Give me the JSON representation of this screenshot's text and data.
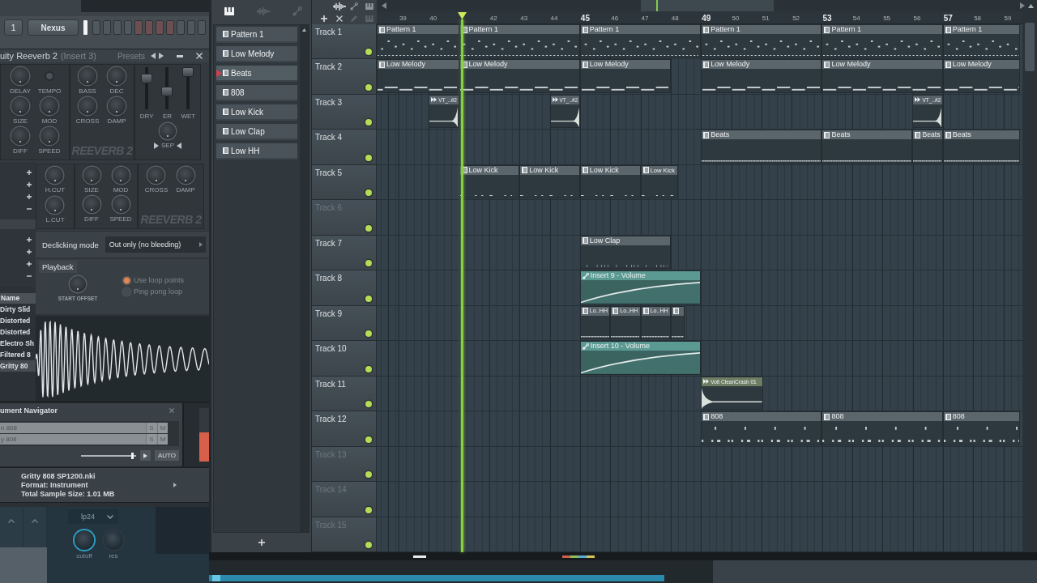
{
  "channel_rack": {
    "rows": [
      {
        "number": "1",
        "name": "Nexus",
        "steps": [
          {
            "on": false
          },
          {
            "on": false
          },
          {
            "on": false
          },
          {
            "on": false
          },
          {
            "on": false
          },
          {
            "on": false
          },
          {
            "on": false
          },
          {
            "on": false
          },
          {
            "on": false
          },
          {
            "on": false
          },
          {
            "on": false
          }
        ]
      }
    ]
  },
  "reverb": {
    "title": "uity Reeverb 2",
    "insert": "(Insert 3)",
    "presets": "Presets",
    "knob_groups": [
      [
        {
          "label": "DELAY",
          "kind": "knob"
        },
        {
          "label": "TEMPO",
          "kind": "led"
        },
        {
          "label": "SIZE",
          "kind": "knob"
        },
        {
          "label": "MOD",
          "kind": "knob"
        },
        {
          "label": "DIFF",
          "kind": "knob"
        },
        {
          "label": "SPEED",
          "kind": "knob"
        }
      ],
      [
        {
          "label": "BASS",
          "kind": "knob"
        },
        {
          "label": "DEC",
          "kind": "knob"
        },
        {
          "label": "CROSS",
          "kind": "knob"
        },
        {
          "label": "DAMP",
          "kind": "knob"
        }
      ]
    ],
    "logo": "REEVERB 2",
    "faders": [
      {
        "label": "DRY",
        "level": 0.8
      },
      {
        "label": "ER",
        "level": 0.4
      },
      {
        "label": "WET",
        "level": 1
      }
    ],
    "sep": "SEP"
  },
  "reverb_lower": {
    "knob_groups": [
      [
        {
          "label": "H.CUT",
          "kind": "knob"
        },
        {
          "label": "L.CUT",
          "kind": "knob"
        }
      ],
      [
        {
          "label": "SIZE",
          "kind": "knob"
        },
        {
          "label": "MOD",
          "kind": "knob"
        },
        {
          "label": "DIFF",
          "kind": "knob"
        },
        {
          "label": "SPEED",
          "kind": "knob"
        }
      ],
      [
        {
          "label": "CROSS",
          "kind": "knob"
        },
        {
          "label": "DAMP",
          "kind": "knob"
        }
      ]
    ],
    "logo": "REEVERB 2"
  },
  "browser": {
    "tree_groups": [
      [
        {
          "expanded": false
        },
        {
          "expanded": false
        },
        {
          "expanded": false
        },
        {
          "expanded": true
        }
      ],
      [
        {
          "expanded": false
        },
        {
          "expanded": false
        },
        {
          "expanded": false
        },
        {
          "expanded": true
        }
      ]
    ],
    "column": "Name",
    "items": [
      {
        "name": "Dirty Slid",
        "selected": false
      },
      {
        "name": "Distorted",
        "selected": false
      },
      {
        "name": "Distorted",
        "selected": false
      },
      {
        "name": "Electro Sh",
        "selected": false
      },
      {
        "name": "Filtered 8",
        "selected": false
      },
      {
        "name": "Gritty 80",
        "selected": true
      }
    ]
  },
  "sampler": {
    "declicking": {
      "label": "Declicking mode",
      "value": "Out only (no bleeding)"
    },
    "playback": {
      "title": "Playback",
      "knob": "START OFFSET",
      "options": [
        {
          "label": "Use loop points",
          "checked": true
        },
        {
          "label": "Ping pong loop",
          "checked": false
        }
      ]
    }
  },
  "instrument_navigator": {
    "title": "ument Navigator",
    "rows": [
      {
        "name": "n 808",
        "solo": "S",
        "mute": "M"
      },
      {
        "name": "y 808",
        "solo": "S",
        "mute": "M"
      }
    ],
    "volume": {
      "level": 0.95
    },
    "auto": "AUTO",
    "meter": {
      "level": 0.55
    }
  },
  "file_info": {
    "lines": [
      "Gritty 808 SP1200.nki",
      "Format: Instrument",
      "Total Sample Size: 1.01 MB"
    ]
  },
  "synth": {
    "filter": "lp24",
    "knobs": [
      {
        "label": "cutoff"
      },
      {
        "label": "res"
      }
    ]
  },
  "playlist": {
    "patterns": [
      {
        "name": "Pattern 1",
        "selected": false
      },
      {
        "name": "Low Melody",
        "selected": false
      },
      {
        "name": "Beats",
        "selected": true
      },
      {
        "name": "808",
        "selected": false
      },
      {
        "name": "Low Kick",
        "selected": false
      },
      {
        "name": "Low Clap",
        "selected": false
      },
      {
        "name": "Low HH",
        "selected": false
      }
    ],
    "ruler": [
      {
        "label": "39",
        "major": false
      },
      {
        "label": "40",
        "major": false
      },
      {
        "label": "42",
        "major": false
      },
      {
        "label": "43",
        "major": false
      },
      {
        "label": "44",
        "major": false
      },
      {
        "label": "45",
        "major": true
      },
      {
        "label": "46",
        "major": false
      },
      {
        "label": "47",
        "major": false
      },
      {
        "label": "48",
        "major": false
      },
      {
        "label": "49",
        "major": true
      },
      {
        "label": "50",
        "major": false
      },
      {
        "label": "51",
        "major": false
      },
      {
        "label": "52",
        "major": false
      },
      {
        "label": "53",
        "major": true
      },
      {
        "label": "54",
        "major": false
      },
      {
        "label": "55",
        "major": false
      },
      {
        "label": "56",
        "major": false
      },
      {
        "label": "57",
        "major": true
      },
      {
        "label": "58",
        "major": false
      },
      {
        "label": "59",
        "major": false
      }
    ],
    "tracks": [
      {
        "name": "Track 1",
        "dimmed": false,
        "muted": false,
        "clips": [
          {
            "kind": "pattern",
            "label": "Pattern 1"
          },
          {
            "kind": "pattern",
            "label": "Pattern 1"
          },
          {
            "kind": "pattern",
            "label": "Pattern 1"
          },
          {
            "kind": "pattern",
            "label": "Pattern 1"
          },
          {
            "kind": "pattern",
            "label": "Pattern 1"
          },
          {
            "kind": "pattern",
            "label": "Pattern 1"
          }
        ]
      },
      {
        "name": "Track 2",
        "dimmed": false,
        "muted": false,
        "clips": [
          {
            "kind": "pattern",
            "label": "Low Melody"
          },
          {
            "kind": "pattern",
            "label": "Low Melody"
          },
          {
            "kind": "pattern",
            "label": "Low Melody"
          },
          {
            "kind": "pattern",
            "label": "Low Melody"
          },
          {
            "kind": "pattern",
            "label": "Low Melody"
          },
          {
            "kind": "pattern",
            "label": "Low Melody"
          }
        ]
      },
      {
        "name": "Track 3",
        "dimmed": false,
        "muted": false,
        "clips": [
          {
            "kind": "audio",
            "label": "VT_..#2",
            "color": "#56616a"
          },
          {
            "kind": "audio",
            "label": "VT_..#2",
            "color": "#56616a"
          },
          {
            "kind": "audio",
            "label": "VT_..#2",
            "color": "#56616a"
          }
        ]
      },
      {
        "name": "Track 4",
        "dimmed": false,
        "muted": false,
        "clips": [
          {
            "kind": "pattern",
            "label": "Beats"
          },
          {
            "kind": "pattern",
            "label": "Beats"
          },
          {
            "kind": "pattern",
            "label": "Beats"
          },
          {
            "kind": "pattern",
            "label": "Beats"
          }
        ]
      },
      {
        "name": "Track 5",
        "dimmed": false,
        "muted": false,
        "clips": [
          {
            "kind": "pattern",
            "label": "Low Kick"
          },
          {
            "kind": "pattern",
            "label": "Low Kick"
          },
          {
            "kind": "pattern",
            "label": "Low Kick"
          },
          {
            "kind": "pattern",
            "label": "Low Kick"
          }
        ]
      },
      {
        "name": "Track 6",
        "dimmed": true,
        "muted": false
      },
      {
        "name": "Track 7",
        "dimmed": false,
        "muted": false,
        "clips": [
          {
            "kind": "pattern",
            "label": "Low Clap"
          }
        ]
      },
      {
        "name": "Track 8",
        "dimmed": false,
        "muted": false,
        "clips": [
          {
            "kind": "automation",
            "label": "Insert 9 - Volume"
          }
        ]
      },
      {
        "name": "Track 9",
        "dimmed": false,
        "muted": false,
        "clips": [
          {
            "kind": "pattern",
            "label": "Lo..HH"
          },
          {
            "kind": "pattern",
            "label": "Lo..HH"
          },
          {
            "kind": "pattern",
            "label": "Lo..HH"
          },
          {
            "kind": "pattern"
          }
        ]
      },
      {
        "name": "Track 10",
        "dimmed": false,
        "muted": false,
        "clips": [
          {
            "kind": "automation",
            "label": "Insert 10 - Volume"
          }
        ]
      },
      {
        "name": "Track 11",
        "dimmed": false,
        "muted": false,
        "clips": [
          {
            "kind": "audio",
            "label": "Volt CleanCrash 01",
            "color": "#6c7d63"
          }
        ]
      },
      {
        "name": "Track 12",
        "dimmed": false,
        "muted": false,
        "clips": [
          {
            "kind": "pattern",
            "label": "808"
          },
          {
            "kind": "pattern",
            "label": "808"
          },
          {
            "kind": "pattern",
            "label": "808"
          }
        ]
      },
      {
        "name": "Track 13",
        "dimmed": true,
        "muted": false
      },
      {
        "name": "Track 14",
        "dimmed": true,
        "muted": false
      },
      {
        "name": "Track 15",
        "dimmed": true,
        "muted": false
      }
    ]
  }
}
